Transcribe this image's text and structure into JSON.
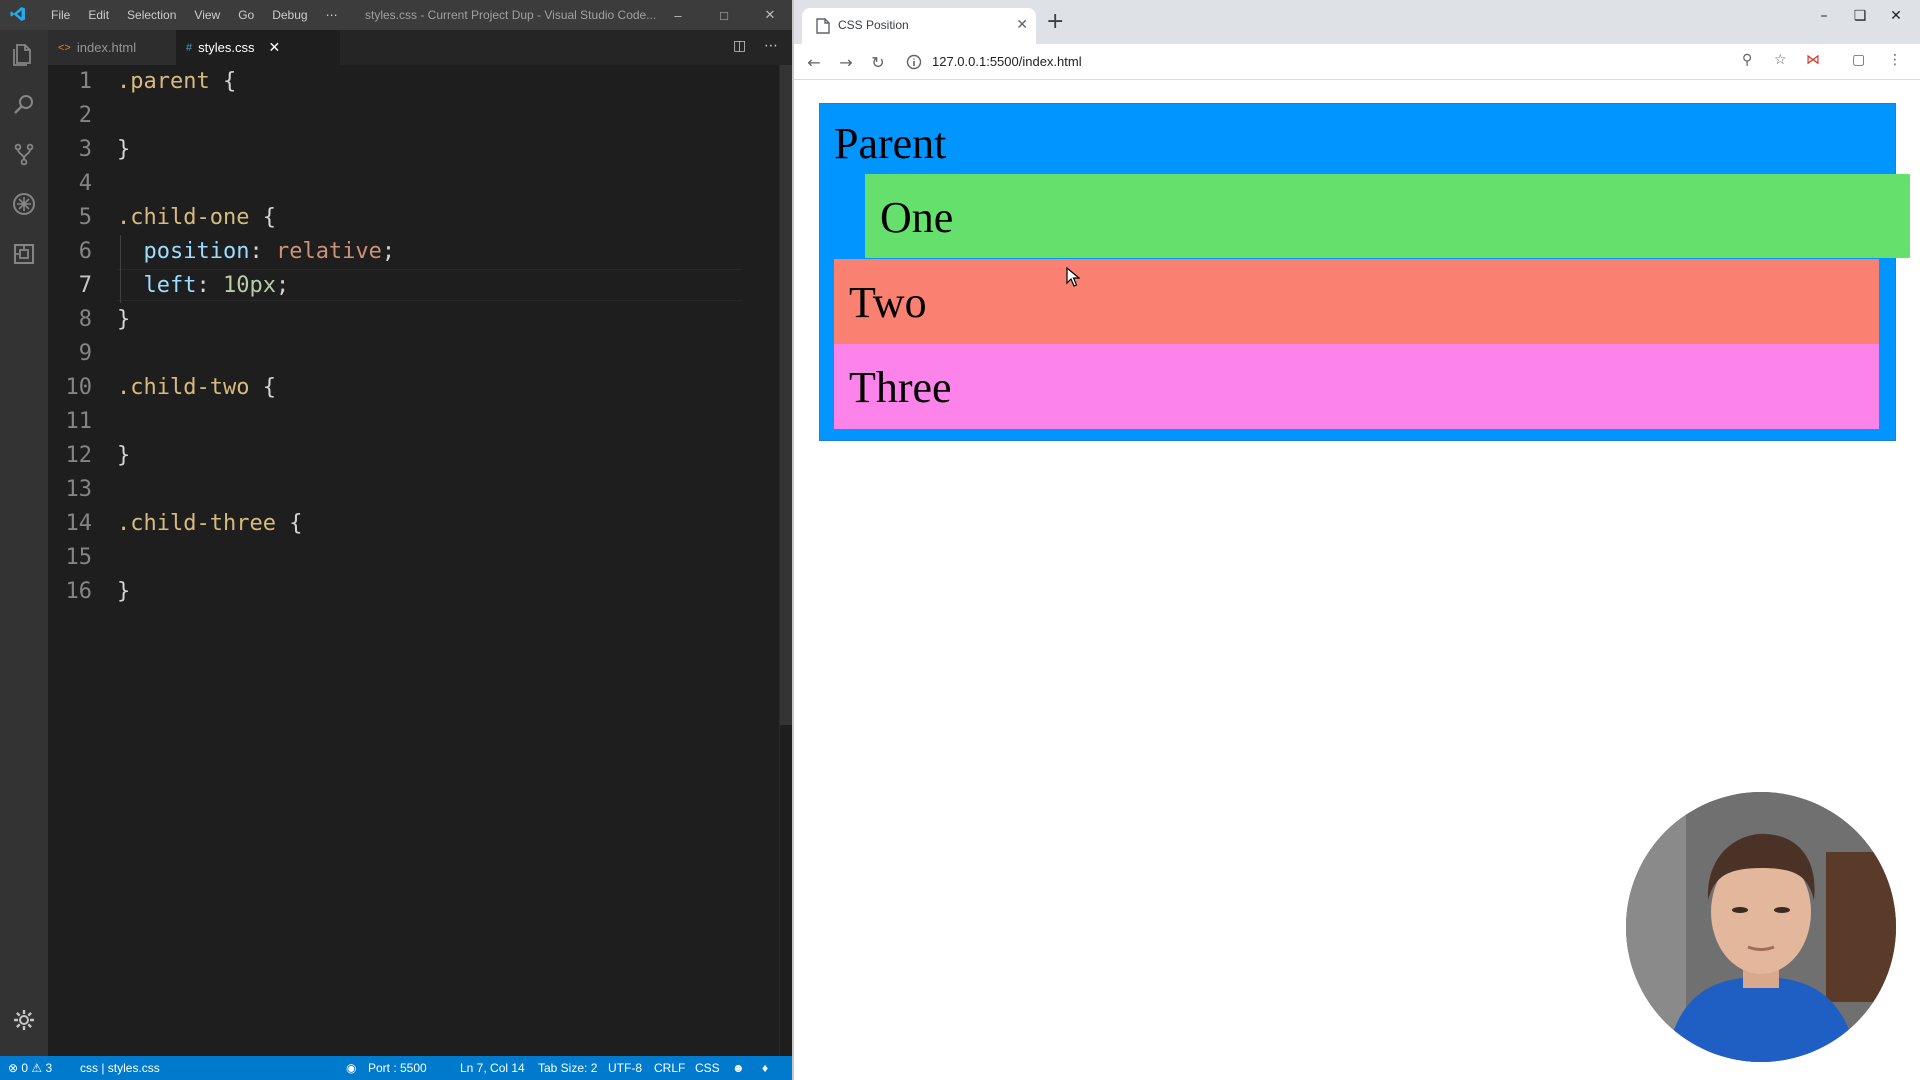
{
  "vscode": {
    "menu": [
      "File",
      "Edit",
      "Selection",
      "View",
      "Go",
      "Debug",
      "⋯"
    ],
    "window_title": "styles.css - Current Project Dup - Visual Studio Code...",
    "tabs": [
      {
        "label": "index.html",
        "glyph": "<>"
      },
      {
        "label": "styles.css",
        "glyph": "#"
      }
    ],
    "lines": [
      {
        "n": "1",
        "tokens": [
          [
            ".parent",
            "sel"
          ],
          [
            " {",
            "punc"
          ]
        ]
      },
      {
        "n": "2",
        "tokens": []
      },
      {
        "n": "3",
        "tokens": [
          [
            "}",
            "punc"
          ]
        ]
      },
      {
        "n": "4",
        "tokens": []
      },
      {
        "n": "5",
        "tokens": [
          [
            ".child-one",
            "sel"
          ],
          [
            " {",
            "punc"
          ]
        ]
      },
      {
        "n": "6",
        "tokens": [
          [
            "  position",
            "prop"
          ],
          [
            ": ",
            "punc"
          ],
          [
            "relative",
            "val"
          ],
          [
            ";",
            "punc"
          ]
        ]
      },
      {
        "n": "7",
        "tokens": [
          [
            "  left",
            "prop"
          ],
          [
            ": ",
            "punc"
          ],
          [
            "10px",
            "num"
          ],
          [
            ";",
            "punc"
          ]
        ]
      },
      {
        "n": "8",
        "tokens": [
          [
            "}",
            "punc"
          ]
        ]
      },
      {
        "n": "9",
        "tokens": []
      },
      {
        "n": "10",
        "tokens": [
          [
            ".child-two",
            "sel"
          ],
          [
            " {",
            "punc"
          ]
        ]
      },
      {
        "n": "11",
        "tokens": []
      },
      {
        "n": "12",
        "tokens": [
          [
            "}",
            "punc"
          ]
        ]
      },
      {
        "n": "13",
        "tokens": []
      },
      {
        "n": "14",
        "tokens": [
          [
            ".child-three",
            "sel"
          ],
          [
            " {",
            "punc"
          ]
        ]
      },
      {
        "n": "15",
        "tokens": []
      },
      {
        "n": "16",
        "tokens": [
          [
            "}",
            "punc"
          ]
        ]
      }
    ],
    "active_line": "7",
    "status": {
      "problems": "⊗ 0 ⚠ 3",
      "breadcrumb": "css | styles.css",
      "live_server": "Port : 5500",
      "position": "Ln 7, Col 14",
      "tab_size": "Tab Size: 2",
      "encoding": "UTF-8",
      "eol": "CRLF",
      "language": "CSS"
    },
    "activity_icons": [
      "files-icon",
      "search-icon",
      "source-control-icon",
      "debug-icon",
      "extensions-icon"
    ]
  },
  "chrome": {
    "tab_title": "CSS Position",
    "url": "127.0.0.1:5500/index.html"
  },
  "demo": {
    "parent": "Parent",
    "one": "One",
    "two": "Two",
    "three": "Three"
  },
  "colors": {
    "parent_bg": "#0095ff",
    "child_one_bg": "#66e06c",
    "child_two_bg": "#fa8071",
    "child_three_bg": "#fb83ea",
    "status_bar": "#007acc"
  }
}
